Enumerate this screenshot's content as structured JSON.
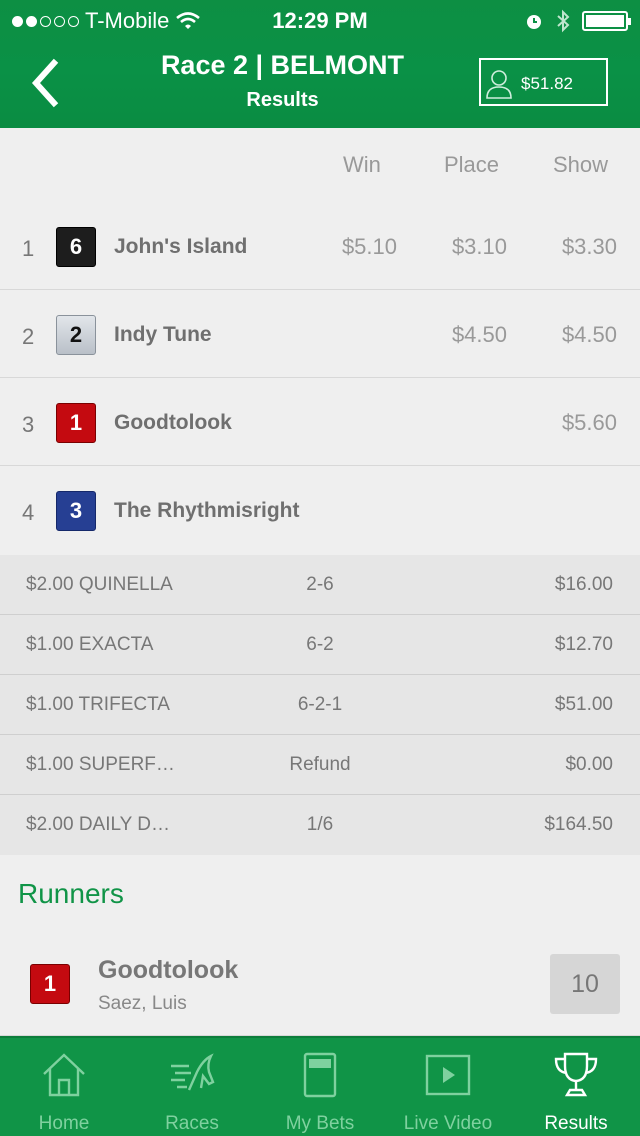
{
  "status_bar": {
    "carrier": "T-Mobile",
    "time": "12:29 PM"
  },
  "header": {
    "title": "Race 2 | BELMONT",
    "subtitle": "Results",
    "balance": "$51.82"
  },
  "results": {
    "columns": [
      "Win",
      "Place",
      "Show"
    ],
    "rows": [
      {
        "pos": "1",
        "pp": "6",
        "color": "#1d1d1d",
        "name": "John's Island",
        "win": "$5.10",
        "place": "$3.10",
        "show": "$3.30"
      },
      {
        "pos": "2",
        "pp": "2",
        "color": "#c8cdd3",
        "name": "Indy Tune",
        "win": "",
        "place": "$4.50",
        "show": "$4.50"
      },
      {
        "pos": "3",
        "pp": "1",
        "color": "#c40a10",
        "name": "Goodtolook",
        "win": "",
        "place": "",
        "show": "$5.60"
      },
      {
        "pos": "4",
        "pp": "3",
        "color": "#263f93",
        "name": "The Rhythmisright",
        "win": "",
        "place": "",
        "show": ""
      }
    ]
  },
  "exotics": [
    {
      "type": "$2.00 QUINELLA",
      "combo": "2-6",
      "payout": "$16.00"
    },
    {
      "type": "$1.00 EXACTA",
      "combo": "6-2",
      "payout": "$12.70"
    },
    {
      "type": "$1.00 TRIFECTA",
      "combo": "6-2-1",
      "payout": "$51.00"
    },
    {
      "type": "$1.00 SUPERF…",
      "combo": "Refund",
      "payout": "$0.00"
    },
    {
      "type": "$2.00 DAILY D…",
      "combo": "1/6",
      "payout": "$164.50"
    }
  ],
  "runners": {
    "title": "Runners",
    "items": [
      {
        "pp": "1",
        "name": "Goodtolook",
        "jockey": "Saez, Luis",
        "odds": "10"
      }
    ]
  },
  "tabs": [
    {
      "label": "Home",
      "icon": "home-icon"
    },
    {
      "label": "Races",
      "icon": "horse-icon"
    },
    {
      "label": "My Bets",
      "icon": "ticket-icon"
    },
    {
      "label": "Live Video",
      "icon": "play-icon"
    },
    {
      "label": "Results",
      "icon": "trophy-icon",
      "active": true
    }
  ],
  "colors": {
    "brand_green": "#109447",
    "header_green": "#0a9146"
  }
}
